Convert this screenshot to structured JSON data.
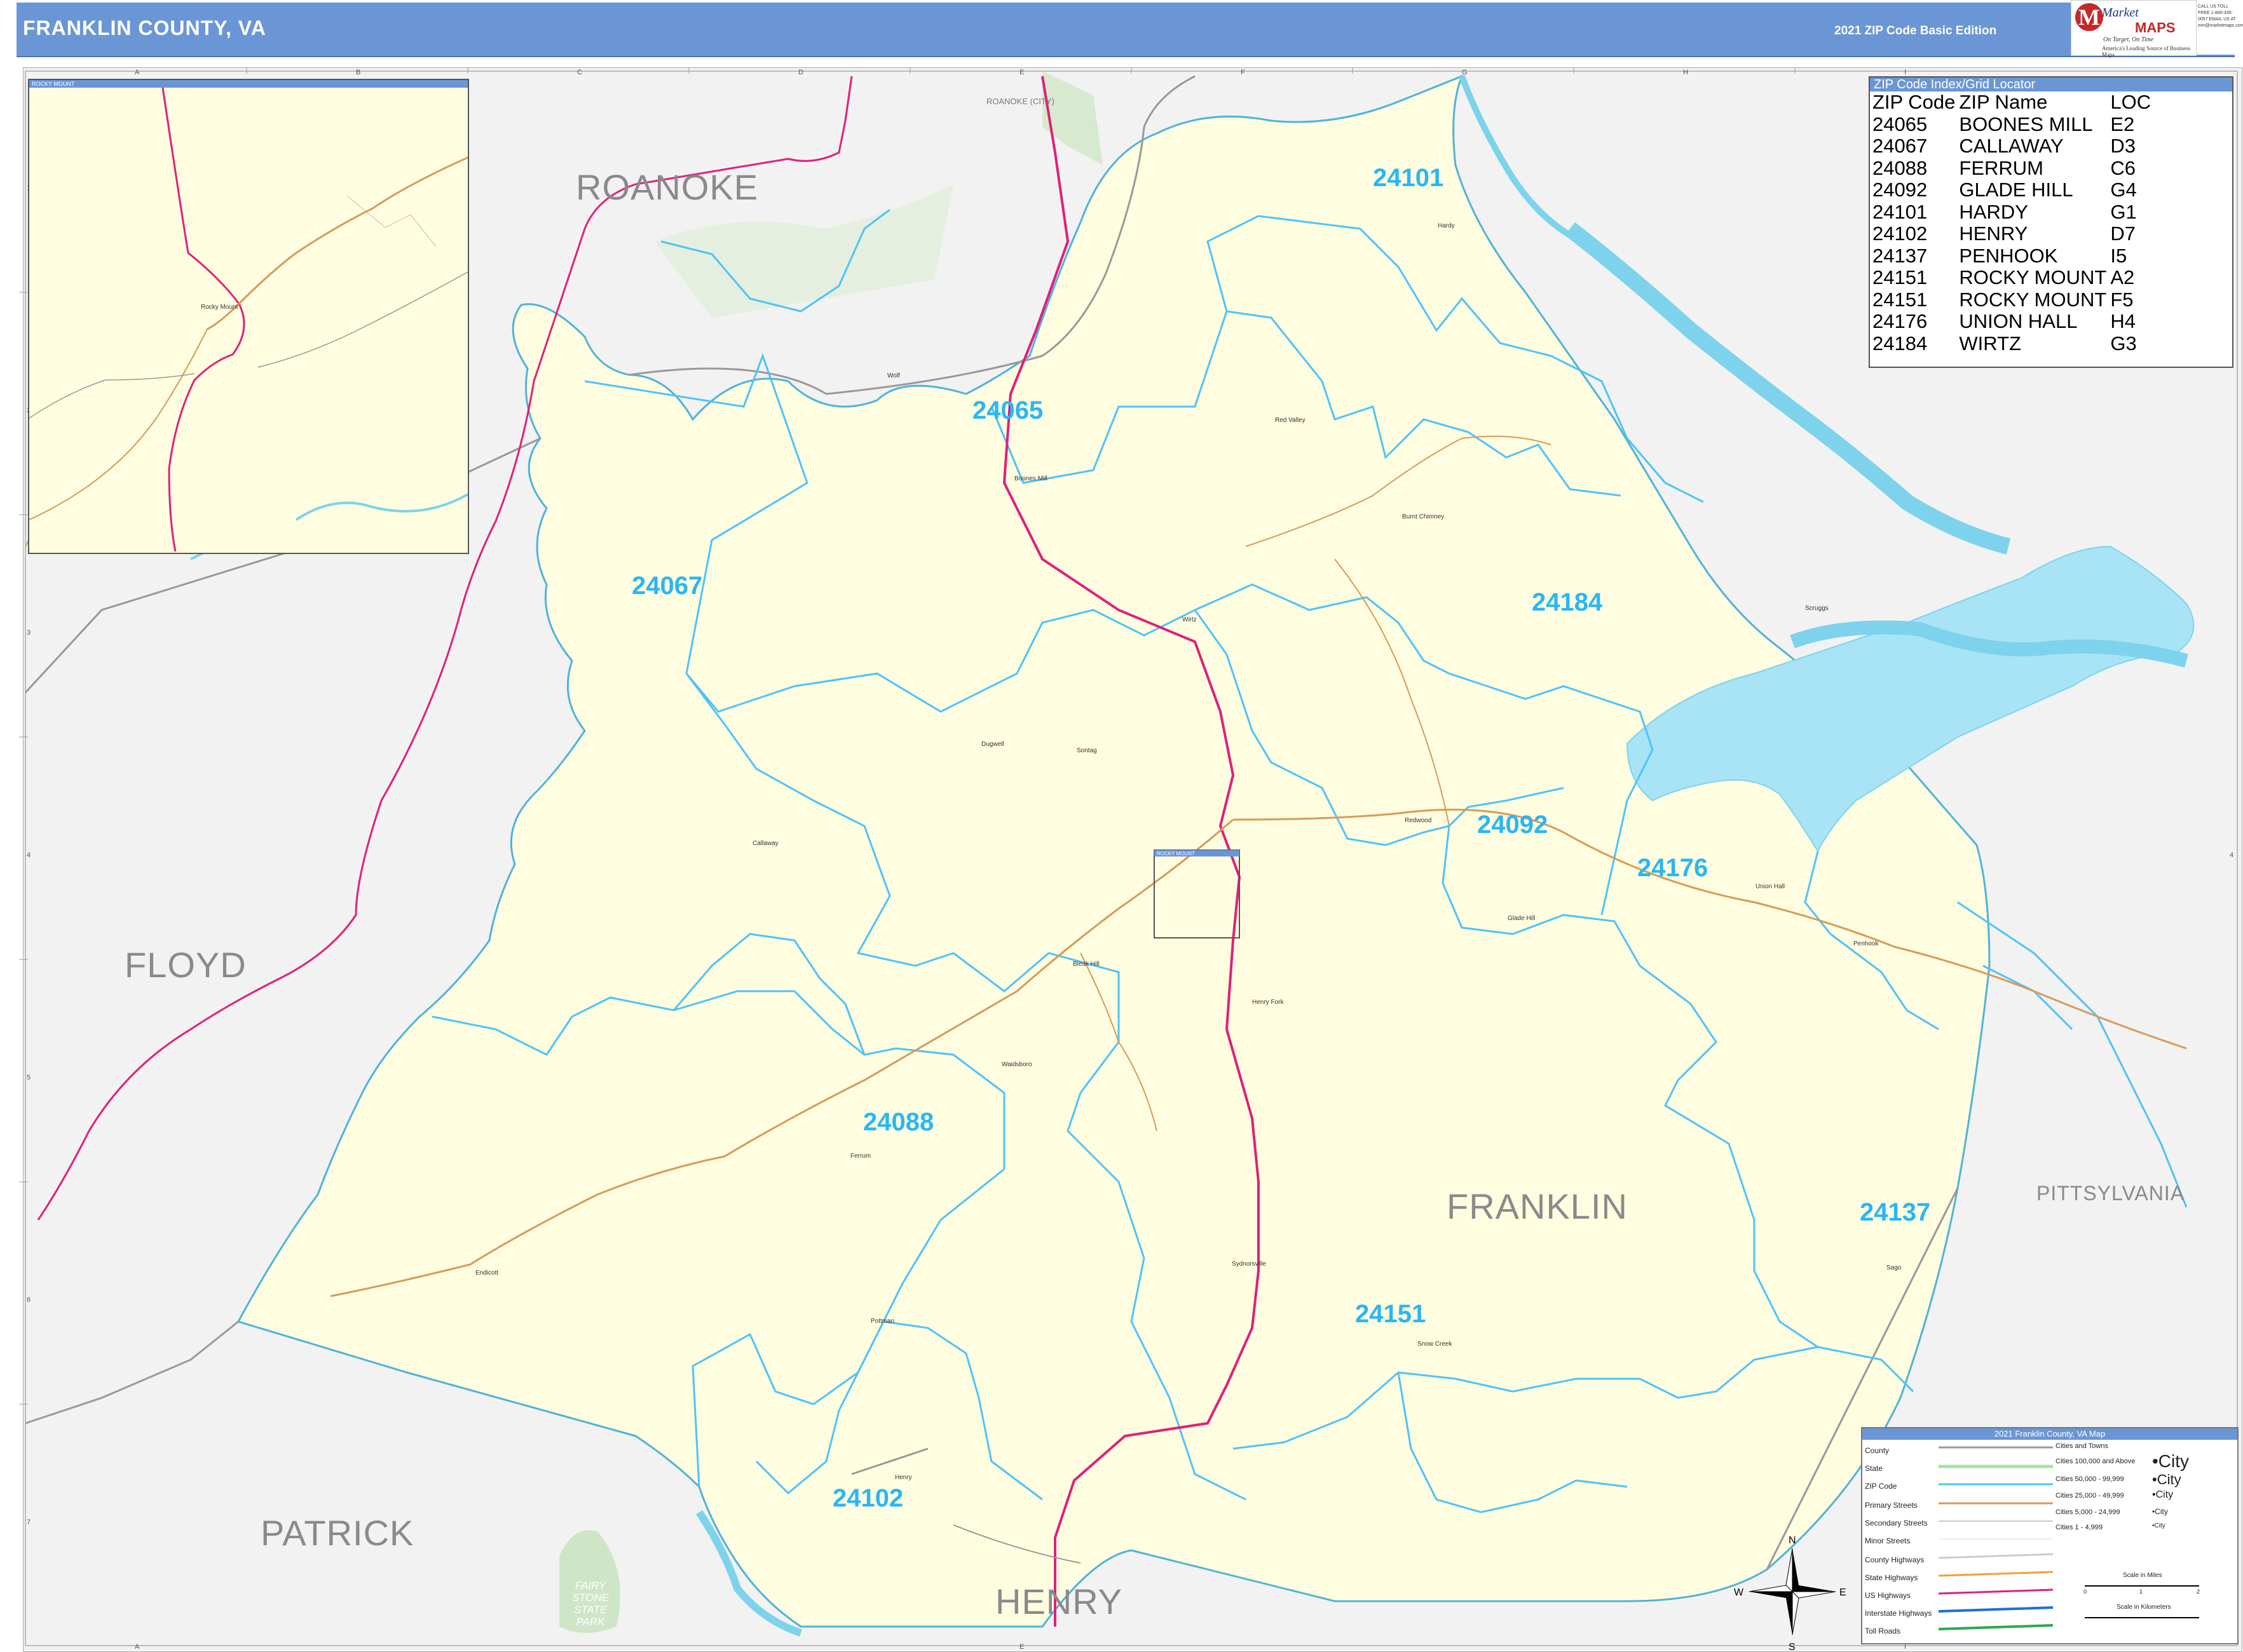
{
  "header": {
    "title": "FRANKLIN COUNTY, VA",
    "edition": "2021 ZIP Code Basic Edition",
    "brand_line1": "Market",
    "brand_line2": "MAPS",
    "brand_tagline": "On Target, On Time",
    "brand_subtitle": "America's Leading Source of Business Maps",
    "contact": "CALL US TOLL FREE 1-800-335-0057 EMAIL US AT mm@marketmaps.com"
  },
  "grid": {
    "columns": [
      "A",
      "B",
      "C",
      "D",
      "E",
      "F",
      "G",
      "H",
      "I"
    ],
    "rows": [
      "1",
      "2",
      "3",
      "4",
      "5",
      "6",
      "7"
    ]
  },
  "zip_index": {
    "title": "ZIP Code Index/Grid Locator",
    "columns": [
      "ZIP Code",
      "ZIP Name",
      "LOC"
    ],
    "rows": [
      [
        "24065",
        "BOONES MILL",
        "E2"
      ],
      [
        "24067",
        "CALLAWAY",
        "D3"
      ],
      [
        "24088",
        "FERRUM",
        "C6"
      ],
      [
        "24092",
        "GLADE HILL",
        "G4"
      ],
      [
        "24101",
        "HARDY",
        "G1"
      ],
      [
        "24102",
        "HENRY",
        "D7"
      ],
      [
        "24137",
        "PENHOOK",
        "I5"
      ],
      [
        "24151",
        "ROCKY MOUNT",
        "A2"
      ],
      [
        "24151",
        "ROCKY MOUNT",
        "F5"
      ],
      [
        "24176",
        "UNION HALL",
        "H4"
      ],
      [
        "24184",
        "WIRTZ",
        "G3"
      ]
    ]
  },
  "inset": {
    "title": "ROCKY MOUNT",
    "town": "Rocky Mount"
  },
  "rocky_mount_box_label": "ROCKY MOUNT",
  "county_labels": [
    "ROANOKE",
    "FLOYD",
    "FRANKLIN",
    "PATRICK",
    "HENRY",
    "PITTSYLVANIA"
  ],
  "roanoke_city_label": "ROANOKE (CITY)",
  "zip_labels": [
    "24101",
    "24065",
    "24067",
    "24184",
    "24092",
    "24176",
    "24088",
    "24137",
    "24151",
    "24102"
  ],
  "towns": [
    "Hardy",
    "Boones Mill",
    "Red Valley",
    "Burnt Chimney",
    "Wirtz",
    "Scruggs",
    "Dugwell",
    "Sontag",
    "Callaway",
    "Redwood",
    "Glade Hill",
    "Union Hall",
    "Penhook",
    "Bleak Hill",
    "Waidsboro",
    "Henry Fork",
    "Ferrum",
    "Endicott",
    "Sydnorsville",
    "Henry",
    "Pottman",
    "Sago",
    "Snow Creek",
    "Wolf"
  ],
  "park_label": "FAIRY STONE STATE PARK",
  "compass": {
    "n": "N",
    "s": "S",
    "e": "E",
    "w": "W"
  },
  "legend": {
    "title": "2021 Franklin County, VA Map",
    "items": [
      "County",
      "State",
      "ZIP Code",
      "Primary Streets",
      "Secondary Streets",
      "Minor Streets",
      "County Highways",
      "State Highways",
      "US Highways",
      "Interstate Highways",
      "Toll Roads"
    ],
    "cities_header": "Cities and Towns",
    "city_classes": [
      "Cities 100,000 and Above",
      "Cities 50,000 - 99,999",
      "Cities 25,000 - 49,999",
      "Cities 5,000 - 24,999",
      "Cities 1 - 4,999"
    ],
    "city_samples": [
      "•City",
      "•City",
      "•City",
      "•City",
      "•City"
    ],
    "scale_miles": "Scale in Miles",
    "scale_km": "Scale in Kilometers",
    "scale_ticks": [
      "0",
      "1",
      "2"
    ]
  },
  "colors": {
    "title_bar": "#6b96d6",
    "county_fill": "#fffde0",
    "zip_boundary": "#4fc3f7",
    "water": "#a8e4f5",
    "us_highway": "#e0207a",
    "primary_street": "#d89a5a",
    "outside_area": "#f2f2f2",
    "park": "#cfe6c6"
  }
}
